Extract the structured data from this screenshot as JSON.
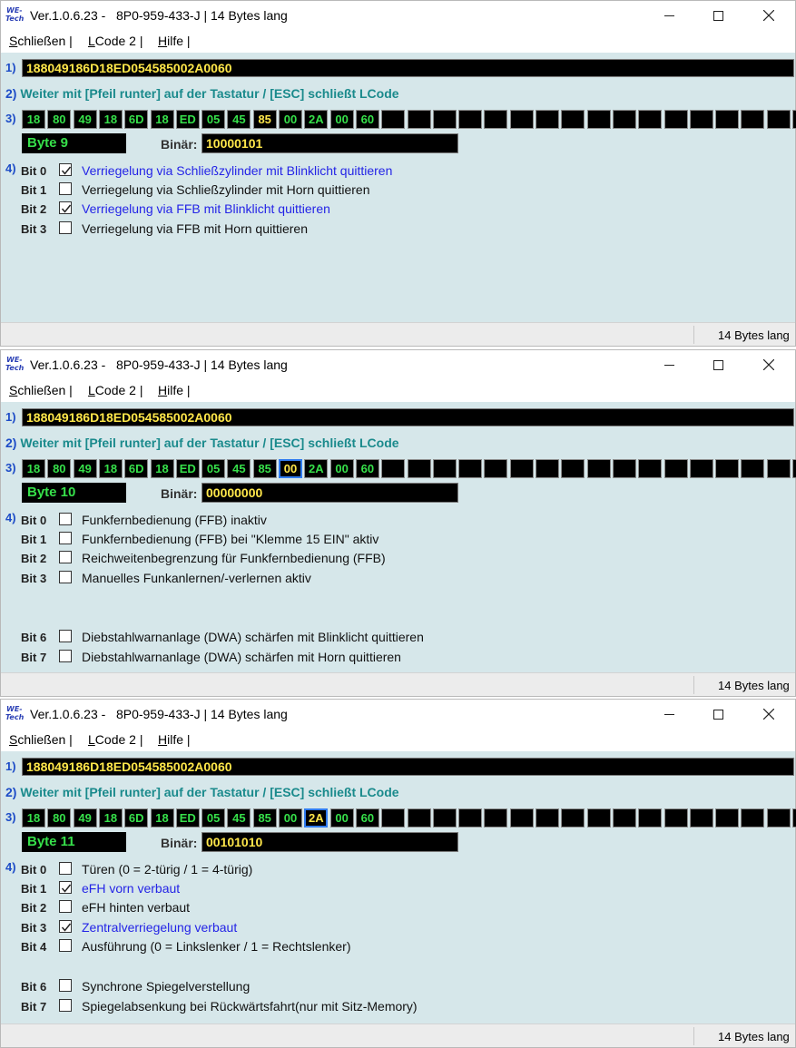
{
  "windows": [
    {
      "title": "Ver.1.0.6.23 -   8P0-959-433-J | 14 Bytes lang",
      "menu": [
        {
          "accel": "S",
          "rest": "chließen |"
        },
        {
          "accel": "L",
          "rest": "Code 2 |"
        },
        {
          "accel": "H",
          "rest": "ilfe |"
        }
      ],
      "n1": "1)",
      "code": "188049186D18ED054585002A0060",
      "n2": "2)",
      "hint": "Weiter mit [Pfeil runter] auf der Tastatur / [ESC] schließt LCode",
      "n3": "3)",
      "bytes": [
        "18",
        "80",
        "49",
        "18",
        "6D",
        "18",
        "ED",
        "05",
        "45",
        "85",
        "00",
        "2A",
        "00",
        "60",
        "",
        "",
        "",
        "",
        "",
        "",
        "",
        "",
        "",
        "",
        "",
        "",
        "",
        "",
        "",
        "",
        ""
      ],
      "active_byte_index": 9,
      "byte_label": "Byte 9",
      "binar_label": "Binär:",
      "binar_value": "10000101",
      "n4": "4)",
      "bits": [
        {
          "label": "Bit 0",
          "checked": true,
          "text": "Verriegelung via Schließzylinder mit Blinklicht quittieren"
        },
        {
          "label": "Bit 1",
          "checked": false,
          "text": "Verriegelung via Schließzylinder mit Horn quittieren"
        },
        {
          "label": "Bit 2",
          "checked": true,
          "text": "Verriegelung via FFB mit Blinklicht quittieren"
        },
        {
          "label": "Bit 3",
          "checked": false,
          "text": "Verriegelung via FFB mit Horn quittieren"
        }
      ],
      "status": "14 Bytes lang"
    },
    {
      "title": "Ver.1.0.6.23 -   8P0-959-433-J | 14 Bytes lang",
      "menu": [
        {
          "accel": "S",
          "rest": "chließen |"
        },
        {
          "accel": "L",
          "rest": "Code 2 |"
        },
        {
          "accel": "H",
          "rest": "ilfe |"
        }
      ],
      "n1": "1)",
      "code": "188049186D18ED054585002A0060",
      "n2": "2)",
      "hint": "Weiter mit [Pfeil runter] auf der Tastatur / [ESC] schließt LCode",
      "n3": "3)",
      "bytes": [
        "18",
        "80",
        "49",
        "18",
        "6D",
        "18",
        "ED",
        "05",
        "45",
        "85",
        "00",
        "2A",
        "00",
        "60",
        "",
        "",
        "",
        "",
        "",
        "",
        "",
        "",
        "",
        "",
        "",
        "",
        "",
        "",
        "",
        "",
        ""
      ],
      "active_byte_index": 10,
      "byte_label": "Byte 10",
      "binar_label": "Binär:",
      "binar_value": "00000000",
      "n4": "4)",
      "bits": [
        {
          "label": "Bit 0",
          "checked": false,
          "text": "Funkfernbedienung (FFB) inaktiv"
        },
        {
          "label": "Bit 1",
          "checked": false,
          "text": "Funkfernbedienung (FFB) bei \"Klemme 15 EIN\" aktiv"
        },
        {
          "label": "Bit 2",
          "checked": false,
          "text": "Reichweitenbegrenzung für Funkfernbedienung (FFB)"
        },
        {
          "label": "Bit 3",
          "checked": false,
          "text": "Manuelles Funkanlernen/-verlernen aktiv"
        },
        {
          "label": "Bit 6",
          "checked": false,
          "text": "Diebstahlwarnanlage (DWA) schärfen mit Blinklicht quittieren"
        },
        {
          "label": "Bit 7",
          "checked": false,
          "text": "Diebstahlwarnanlage (DWA) schärfen mit Horn quittieren"
        }
      ],
      "status": "14 Bytes lang"
    },
    {
      "title": "Ver.1.0.6.23 -   8P0-959-433-J | 14 Bytes lang",
      "menu": [
        {
          "accel": "S",
          "rest": "chließen |"
        },
        {
          "accel": "L",
          "rest": "Code 2 |"
        },
        {
          "accel": "H",
          "rest": "ilfe |"
        }
      ],
      "n1": "1)",
      "code": "188049186D18ED054585002A0060",
      "n2": "2)",
      "hint": "Weiter mit [Pfeil runter] auf der Tastatur / [ESC] schließt LCode",
      "n3": "3)",
      "bytes": [
        "18",
        "80",
        "49",
        "18",
        "6D",
        "18",
        "ED",
        "05",
        "45",
        "85",
        "00",
        "2A",
        "00",
        "60",
        "",
        "",
        "",
        "",
        "",
        "",
        "",
        "",
        "",
        "",
        "",
        "",
        "",
        "",
        "",
        "",
        ""
      ],
      "active_byte_index": 11,
      "byte_label": "Byte 11",
      "binar_label": "Binär:",
      "binar_value": "00101010",
      "n4": "4)",
      "bits": [
        {
          "label": "Bit 0",
          "checked": false,
          "text": "Türen (0 = 2-türig / 1 = 4-türig)"
        },
        {
          "label": "Bit 1",
          "checked": true,
          "text": "eFH vorn verbaut"
        },
        {
          "label": "Bit 2",
          "checked": false,
          "text": "eFH hinten verbaut"
        },
        {
          "label": "Bit 3",
          "checked": true,
          "text": "Zentralverriegelung verbaut"
        },
        {
          "label": "Bit 4",
          "checked": false,
          "text": "Ausführung (0 = Linkslenker / 1 = Rechtslenker)"
        },
        {
          "label": "Bit 6",
          "checked": false,
          "text": "Synchrone Spiegelverstellung"
        },
        {
          "label": "Bit 7",
          "checked": false,
          "text": "Spiegelabsenkung bei Rückwärtsfahrt(nur mit Sitz-Memory)"
        }
      ],
      "status": "14 Bytes lang"
    }
  ],
  "icon_text": [
    "WE-",
    "Tech"
  ],
  "colors": {
    "client_bg": "#d6e7ea",
    "byte_text": "#36e04a",
    "value_text": "#ffe74a",
    "checked_text": "#2424e6",
    "hint_text": "#1a8a8c",
    "selected_border": "#2f7bf0"
  }
}
